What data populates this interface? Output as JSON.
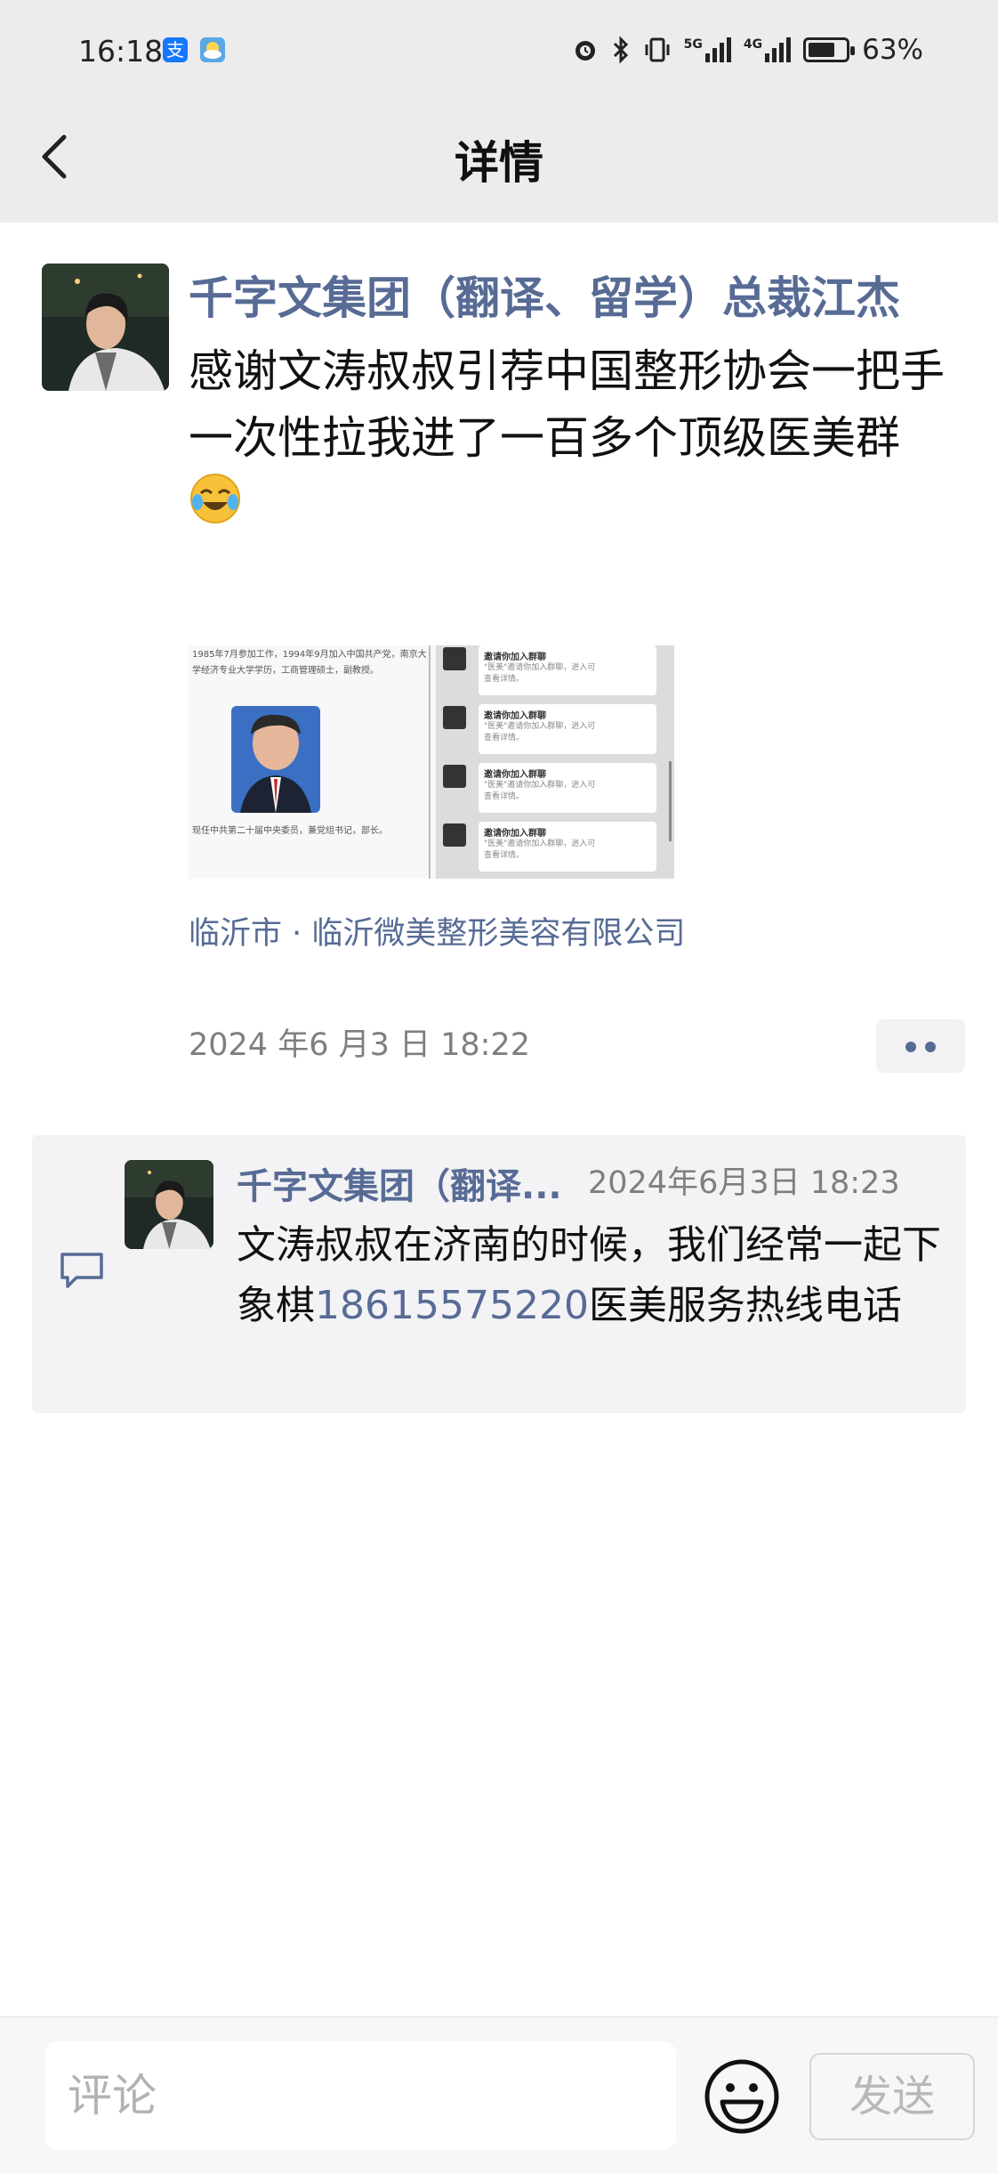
{
  "status_bar": {
    "time": "16:18",
    "battery_level": "63%",
    "battery_fraction": 0.63,
    "signal_a": "5G",
    "signal_b": "4G",
    "left_icons": [
      "alipay-icon",
      "weather-icon"
    ],
    "right_icons": [
      "alarm-icon",
      "bluetooth-icon",
      "vibrate-icon",
      "signal-5g-icon",
      "signal-4g-icon",
      "battery-icon"
    ]
  },
  "header": {
    "title": "详情",
    "back_icon": "chevron-left-icon"
  },
  "post": {
    "author": "千字文集团（翻译、留学）总裁江杰",
    "text_line1": "感谢文涛叔叔引荐中国整形协会一把手",
    "text_line2": "一次性拉我进了一百多个顶级医美群",
    "emoji": "laughing-crying-emoji",
    "image": {
      "left_caption_top": "1985年7月参加工作，1994年9月加入中国共产党，南京大学经济专业大学学历，工商管理硕士，副教授。",
      "left_caption_bottom": "现任中共第二十届中央委员，兼党组书记，部长。",
      "chat_title": "邀请你加入群聊",
      "chat_desc": "\"医美\"邀请你加入群聊，进入可查看详情。"
    },
    "location": "临沂市 · 临沂微美整形美容有限公司",
    "time": "2024 年6 月3 日 18:22",
    "more_icon": "more-dots-icon"
  },
  "comment": {
    "icon": "comment-bubble-icon",
    "author": "千字文集团（翻译...",
    "time": "2024年6月3日 18:23",
    "text_before": "文涛叔叔在济南的时候，我们经常一起下象棋",
    "phone": "18615575220",
    "text_after": "医美服务热线电话"
  },
  "bottom_bar": {
    "input_placeholder": "评论",
    "emoji_icon": "smiley-icon",
    "send_label": "发送"
  },
  "colors": {
    "link": "#576b95",
    "header_bg": "#ececec",
    "comment_bg": "#f3f3f5",
    "muted_text": "#7f7f7f"
  }
}
